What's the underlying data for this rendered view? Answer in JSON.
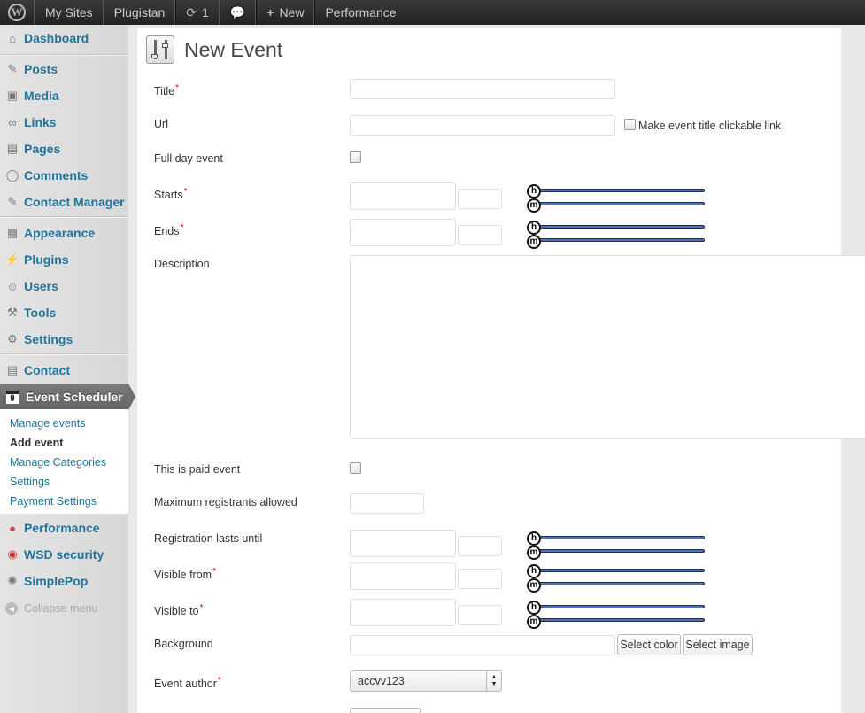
{
  "adminbar": {
    "my_sites": "My Sites",
    "site_name": "Plugistan",
    "updates_count": "1",
    "new_label": "New",
    "performance": "Performance"
  },
  "sidebar": {
    "items": {
      "dashboard": "Dashboard",
      "posts": "Posts",
      "media": "Media",
      "links": "Links",
      "pages": "Pages",
      "comments": "Comments",
      "contact_manager": "Contact Manager",
      "appearance": "Appearance",
      "plugins": "Plugins",
      "users": "Users",
      "tools": "Tools",
      "settings": "Settings",
      "contact": "Contact",
      "event_scheduler": "Event Scheduler",
      "performance": "Performance",
      "wsd_security": "WSD security",
      "simplepop": "SimplePop"
    },
    "calendar_day": "9",
    "submenu": {
      "manage_events": "Manage events",
      "add_event": "Add event",
      "manage_categories": "Manage Categories",
      "settings": "Settings",
      "payment_settings": "Payment Settings"
    },
    "collapse": "Collapse menu"
  },
  "page": {
    "title": "New Event"
  },
  "form": {
    "title_label": "Title",
    "url_label": "Url",
    "clickable_label": "Make event title clickable link",
    "full_day_label": "Full day event",
    "starts_label": "Starts",
    "ends_label": "Ends",
    "description_label": "Description",
    "paid_label": "This is paid event",
    "max_registrants_label": "Maximum registrants allowed",
    "registration_until_label": "Registration lasts until",
    "visible_from_label": "Visible from",
    "visible_to_label": "Visible to",
    "background_label": "Background",
    "select_color": "Select color",
    "select_image": "Select image",
    "author_label": "Event author",
    "author_value": "accvv123",
    "required_mark": "*",
    "hour_handle": "h",
    "minute_handle": "m"
  }
}
